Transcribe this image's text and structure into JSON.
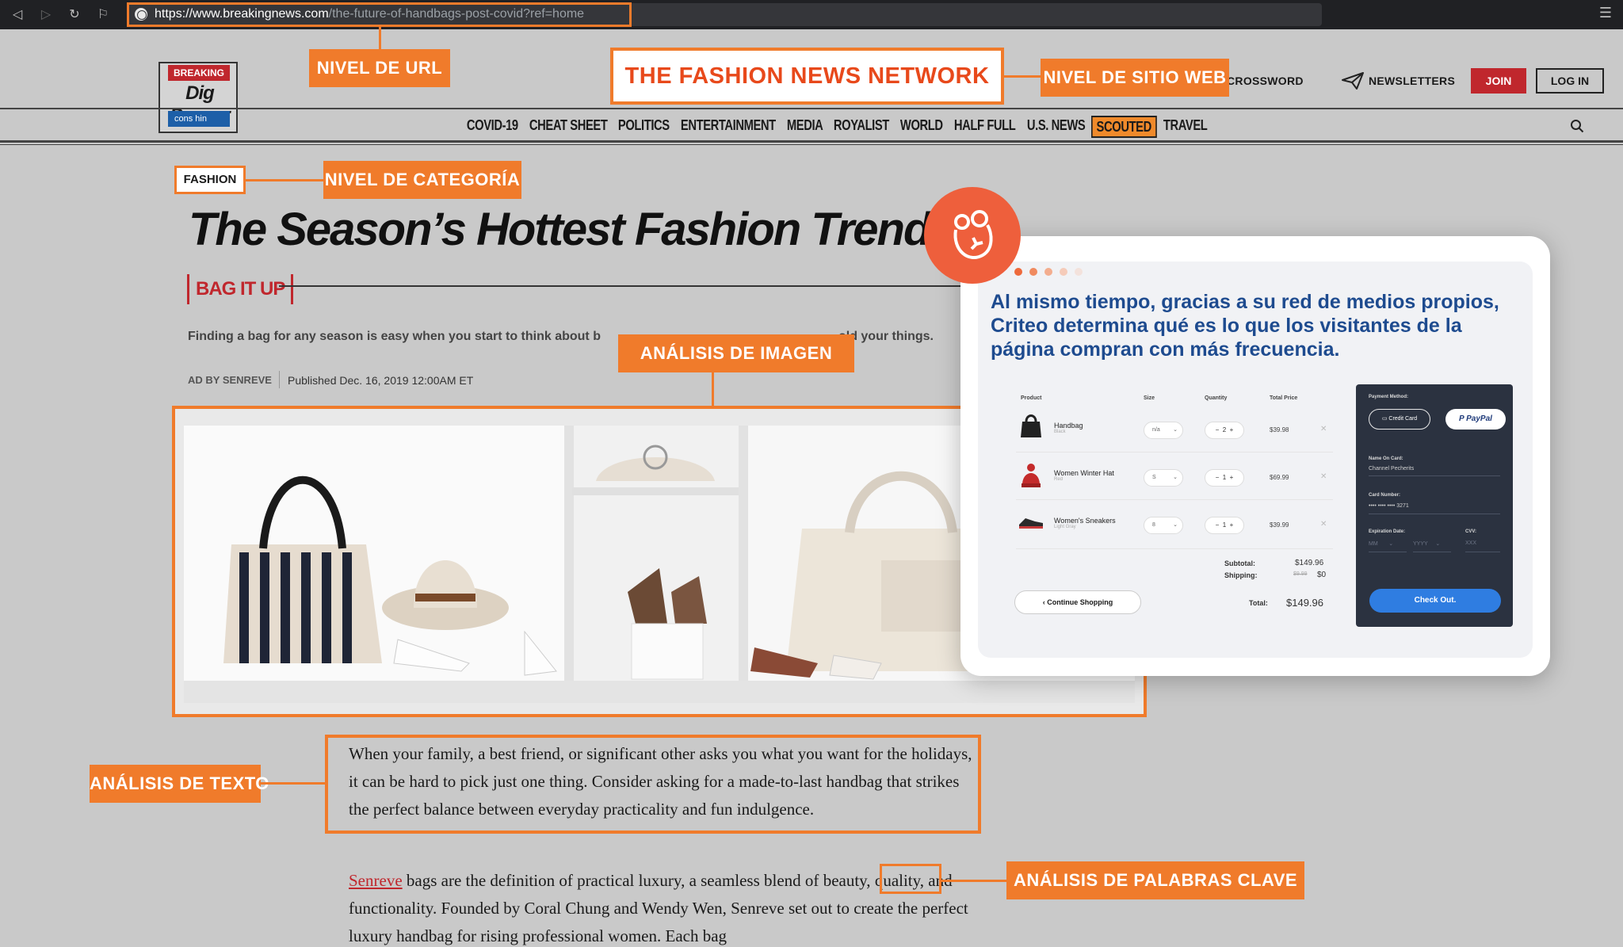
{
  "browser": {
    "url_host": "https://www.breakingnews.com",
    "url_path": "/the-future-of-handbags-post-covid?ref=home",
    "back_icon": "back-arrow-icon",
    "forward_icon": "forward-arrow-icon",
    "reload_icon": "reload-icon",
    "bookmark_icon": "bookmark-icon",
    "menu_icon": "menu-icon"
  },
  "site": {
    "logo_badge": "BREAKING",
    "logo_title": "Dig Deeper",
    "logo_sub": "cons hin",
    "crossword": "CROSSWORD",
    "newsletters": "NEWSLETTERS",
    "join": "JOIN",
    "login": "LOG IN",
    "nav": [
      "COVID-19",
      "CHEAT SHEET",
      "POLITICS",
      "ENTERTAINMENT",
      "MEDIA",
      "ROYALIST",
      "WORLD",
      "HALF FULL",
      "U.S. NEWS",
      "SCOUTED",
      "TRAVEL"
    ],
    "active_nav": "SCOUTED"
  },
  "article": {
    "category": "FASHION",
    "headline": "The Season’s Hottest Fashion Trends",
    "kicker": "BAG IT UP",
    "dek_start": "Finding a bag for any season is easy when you start to think about b",
    "dek_end": "old your things.",
    "byline": "AD BY SENREVE",
    "published": "Published Dec. 16, 2019 12:00AM ET",
    "paragraph1": "When your family, a best friend, or significant other asks you what you want for the holidays, it can be hard to pick just one thing. Consider asking for a made-to-last handbag that strikes the perfect balance between everyday practicality and fun indulgence.",
    "p2_link": "Senreve",
    "p2_before_kw": " bags are the definition of practical luxury, a seamless blend of ",
    "p2_keyword": "beauty,",
    "p2_rest": " quality, and functionality. Founded by Coral Chung and Wendy Wen, Senreve set out to create the perfect luxury handbag for rising professional women. Each bag"
  },
  "callouts": {
    "url": "NIVEL DE URL",
    "network": "THE FASHION NEWS NETWORK",
    "site": "NIVEL DE SITIO WEB",
    "category": "NIVEL DE CATEGORÍA",
    "image": "ANÁLISIS DE IMAGEN",
    "text": "ANÁLISIS DE TEXTO",
    "keywords": "ANÁLISIS DE PALABRAS CLAVE"
  },
  "overlay": {
    "text": "Al mismo tiempo, gracias a su red de medios propios, Criteo determina qué es lo que los visitantes de la página compran con más frecuencia.",
    "badge_icon": "criteo-icon",
    "cart": {
      "headers": [
        "Product",
        "Size",
        "Quantity",
        "Total Price"
      ],
      "items": [
        {
          "name": "Handbag",
          "variant": "Black",
          "size": "n/a",
          "qty": "2",
          "price": "$39.98"
        },
        {
          "name": "Women Winter Hat",
          "variant": "Red",
          "size": "S",
          "qty": "1",
          "price": "$69.99"
        },
        {
          "name": "Women's Sneakers",
          "variant": "Light Gray",
          "size": "8",
          "qty": "1",
          "price": "$39.99"
        }
      ],
      "subtotal_label": "Subtotal:",
      "subtotal": "$149.96",
      "shipping_label": "Shipping:",
      "shipping_old": "$9.99",
      "shipping": "$0",
      "total_label": "Total:",
      "total": "$149.96",
      "continue": "Continue Shopping"
    },
    "payment": {
      "method_label": "Payment Method:",
      "credit": "Credit Card",
      "paypal": "PayPal",
      "name_label": "Name On Card:",
      "name": "Channel Pecherits",
      "card_label": "Card Number:",
      "card": "•••• •••• •••• 3271",
      "exp_label": "Expiration Date:",
      "cvv_label": "CVV:",
      "mm": "MM",
      "yyyy": "YYYY",
      "cvv": "XXX",
      "checkout": "Check Out."
    }
  },
  "colors": {
    "callout": "#f07b2b",
    "brand_red": "#c0272d",
    "criteo_blue": "#1e4b8f",
    "checkout_blue": "#2f7de1"
  }
}
